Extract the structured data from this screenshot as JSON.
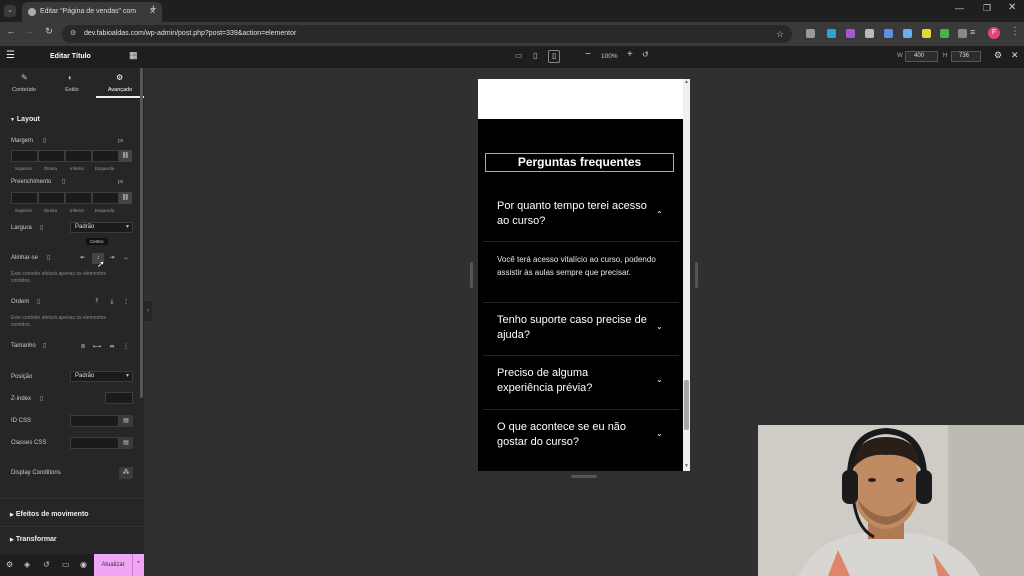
{
  "browser": {
    "tab_title": "Editar “Página de vendas” com",
    "url": "dev.fabioaldas.com/wp-admin/post.php?post=339&action=elementor",
    "profile_initial": "F"
  },
  "editor_top": {
    "zoom": "100%",
    "width_label": "W",
    "width_value": "400",
    "height_label": "H",
    "height_value": "736"
  },
  "panel": {
    "title": "Editar Título",
    "tabs": [
      {
        "label": "Conteúdo",
        "icon": "pencil-icon"
      },
      {
        "label": "Estilo",
        "icon": "contrast-icon"
      },
      {
        "label": "Avançado",
        "icon": "gear-icon"
      }
    ],
    "layout_section": "Layout",
    "margem_label": "Margem",
    "unit": "px",
    "preenchimento_label": "Preenchimento",
    "sides": [
      "Superior",
      "Direita",
      "Inferior",
      "Esquerda"
    ],
    "largura_label": "Largura",
    "largura_value": "Padrão",
    "alinhar_label": "Alinhar-se",
    "tooltip": "Centro",
    "alinhar_note": "Este controle afetará apenas os elementos contidos.",
    "ordem_label": "Ordem",
    "ordem_note": "Este controle afetará apenas os elementos contidos.",
    "tamanho_label": "Tamanho",
    "posicao_label": "Posição",
    "posicao_value": "Padrão",
    "zindex_label": "Z-index",
    "idcss_label": "ID CSS",
    "classes_label": "Classes CSS",
    "display_label": "Display Conditions",
    "efeitos_section": "Efeitos de movimento",
    "transformar_section": "Transformar",
    "update_button": "Atualizar"
  },
  "preview": {
    "faq_title": "Perguntas frequentes",
    "questions": [
      "Por quanto tempo terei acesso ao curso?",
      "Tenho suporte caso precise de ajuda?",
      "Preciso de alguma experiência prévia?",
      "O que acontece se eu não gostar do curso?"
    ],
    "answer": "Você terá acesso vitalício ao curso, podendo assistir às aulas sempre que precisar."
  },
  "colors": {
    "accent_pink": "#d48ee0",
    "update_button_bg": "#f0a6f5"
  }
}
